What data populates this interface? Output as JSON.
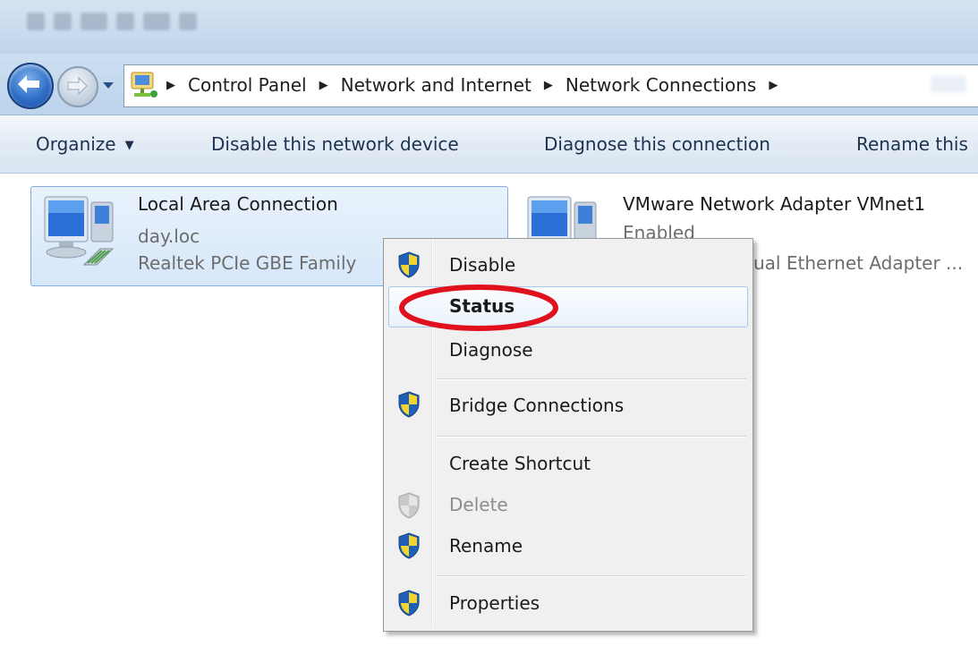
{
  "window": {
    "address_bar": {
      "breadcrumbs": [
        {
          "label": "Control Panel"
        },
        {
          "label": "Network and Internet"
        },
        {
          "label": "Network Connections"
        }
      ]
    }
  },
  "toolbar": {
    "organize_label": "Organize",
    "disable_device_label": "Disable this network device",
    "diagnose_label": "Diagnose this connection",
    "rename_label": "Rename this"
  },
  "connections": [
    {
      "name": "Local Area Connection",
      "status": "day.loc",
      "adapter": "Realtek PCIe GBE Family"
    },
    {
      "name": "VMware Network Adapter VMnet1",
      "status": "Enabled",
      "adapter": "ual Ethernet Adapter ..."
    }
  ],
  "context_menu": {
    "items": [
      {
        "label": "Disable",
        "icon": "uac-shield-icon"
      },
      {
        "label": "Status"
      },
      {
        "label": "Diagnose"
      },
      {
        "label": "Bridge Connections",
        "icon": "uac-shield-icon"
      },
      {
        "label": "Create Shortcut"
      },
      {
        "label": "Delete",
        "icon": "uac-shield-icon",
        "disabled": true
      },
      {
        "label": "Rename",
        "icon": "uac-shield-icon"
      },
      {
        "label": "Properties",
        "icon": "uac-shield-icon"
      }
    ],
    "highlighted_item": "Status"
  },
  "colors": {
    "accent_blue": "#2f6ec7",
    "selection_fill": "#d6e7f9",
    "annotation_red": "#e0101c"
  }
}
